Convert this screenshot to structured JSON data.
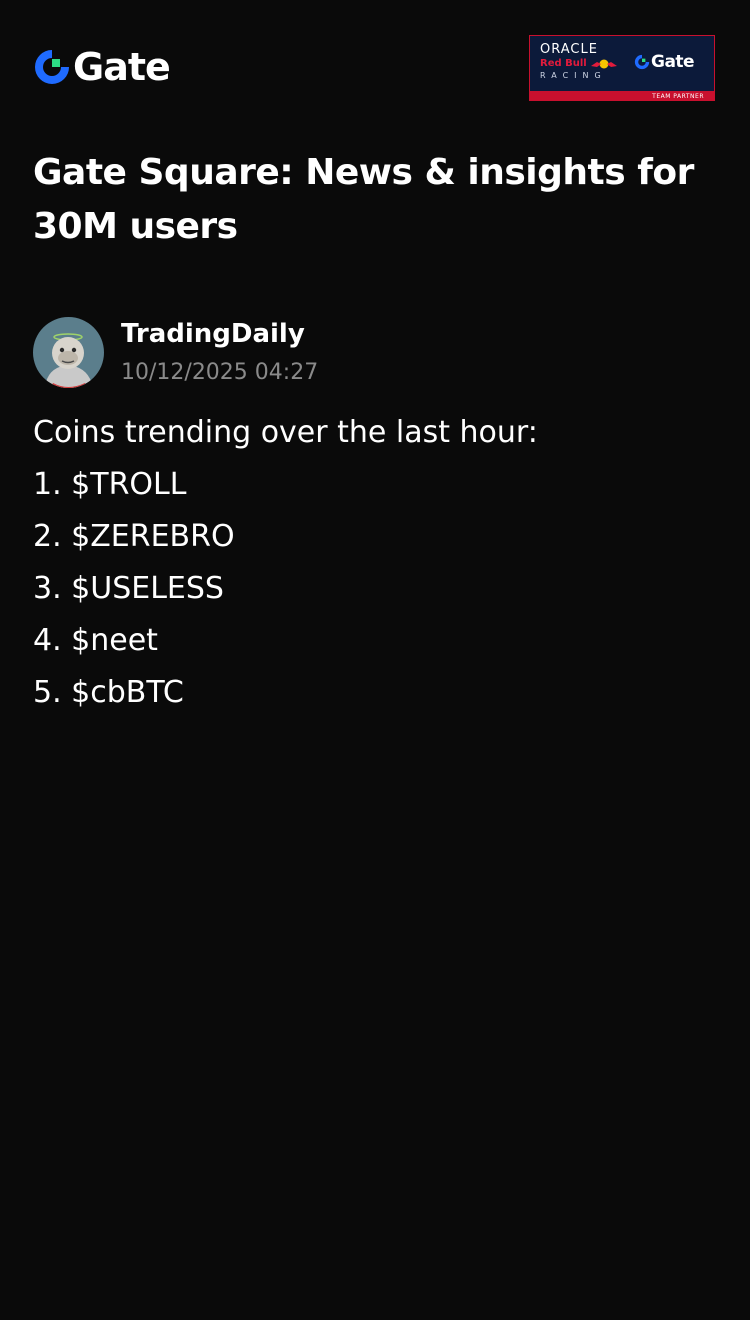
{
  "header": {
    "logo_text": "Gate",
    "partner_badge": {
      "oracle": "ORACLE",
      "redbull": "Red Bull",
      "racing": "RACING",
      "gate": "Gate",
      "partner": "TEAM PARTNER"
    }
  },
  "page_title": "Gate Square: News & insights for 30M users",
  "post": {
    "author": "TradingDaily",
    "timestamp": "10/12/2025 04:27",
    "lines": [
      "Coins trending over the last hour:",
      "1. $TROLL",
      "2. $ZEREBRO",
      "3. $USELESS",
      "4. $neet",
      "5. $cbBTC"
    ]
  },
  "colors": {
    "background": "#0a0a0a",
    "text": "#ffffff",
    "muted": "#8a8a8a",
    "brand_blue": "#1f6bff",
    "brand_green": "#2ddc85",
    "badge_navy": "#0c1a3a",
    "badge_red": "#c8102e"
  },
  "icons": {
    "logo": "gate-logo-icon",
    "avatar": "user-avatar"
  }
}
